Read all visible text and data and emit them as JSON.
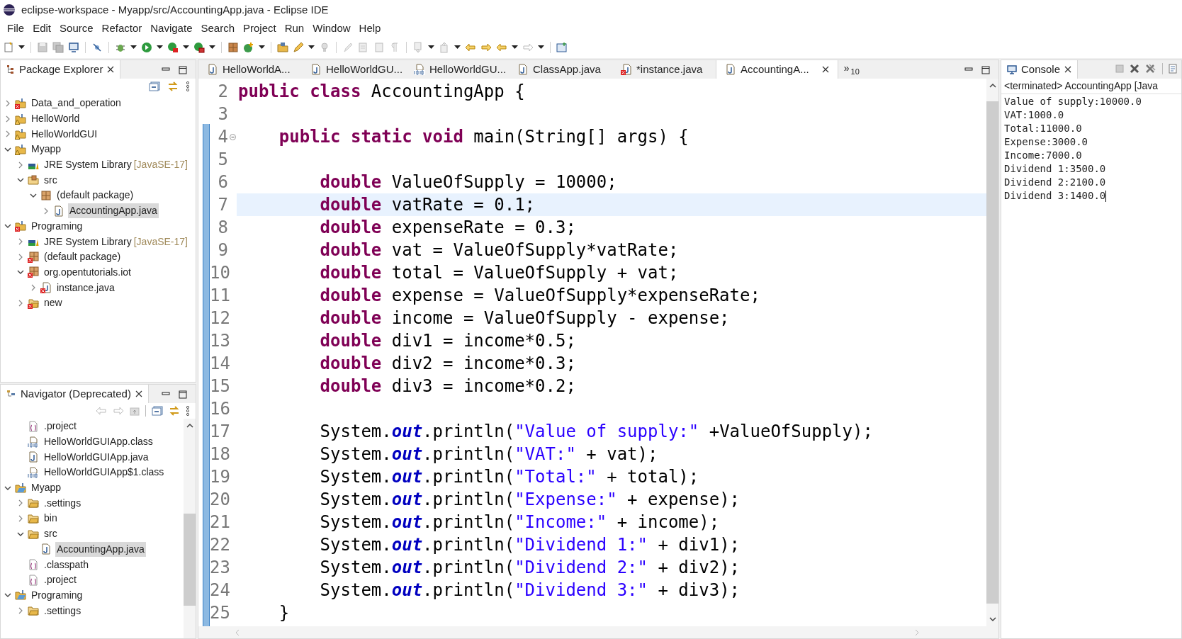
{
  "window": {
    "title": "eclipse-workspace - Myapp/src/AccountingApp.java - Eclipse IDE"
  },
  "menu": [
    {
      "label": "File"
    },
    {
      "label": "Edit"
    },
    {
      "label": "Source"
    },
    {
      "label": "Refactor"
    },
    {
      "label": "Navigate"
    },
    {
      "label": "Search"
    },
    {
      "label": "Project"
    },
    {
      "label": "Run"
    },
    {
      "label": "Window"
    },
    {
      "label": "Help"
    }
  ],
  "package_explorer": {
    "title": "Package Explorer",
    "items": [
      {
        "label": "Data_and_operation",
        "kind": "project-error",
        "expanded": false,
        "selected": false
      },
      {
        "label": "HelloWorld",
        "kind": "project-warning",
        "expanded": false,
        "selected": false
      },
      {
        "label": "HelloWorldGUI",
        "kind": "project-warning",
        "expanded": false,
        "selected": false
      },
      {
        "label": "Myapp",
        "kind": "project-warning",
        "expanded": true,
        "selected": false,
        "children": [
          {
            "label": "JRE System Library",
            "suffix": "[JavaSE-17]",
            "kind": "library",
            "expanded": false,
            "selected": false
          },
          {
            "label": "src",
            "kind": "source-folder",
            "expanded": true,
            "selected": false,
            "children": [
              {
                "label": "(default package)",
                "kind": "package",
                "expanded": true,
                "selected": false,
                "children": [
                  {
                    "label": "AccountingApp.java",
                    "kind": "java-file",
                    "expanded": false,
                    "selected": true
                  }
                ]
              }
            ]
          }
        ]
      },
      {
        "label": "Programing",
        "kind": "project-error",
        "expanded": true,
        "selected": false,
        "children": [
          {
            "label": "JRE System Library",
            "suffix": "[JavaSE-17]",
            "kind": "library",
            "expanded": false,
            "selected": false
          },
          {
            "label": "(default package)",
            "kind": "package-error",
            "expanded": false,
            "selected": false
          },
          {
            "label": "org.opentutorials.iot",
            "kind": "package-error",
            "expanded": true,
            "selected": false,
            "children": [
              {
                "label": "instance.java",
                "kind": "java-error",
                "expanded": false,
                "selected": false
              }
            ]
          },
          {
            "label": "new",
            "kind": "folder-error",
            "expanded": false,
            "selected": false
          }
        ]
      }
    ]
  },
  "navigator": {
    "title": "Navigator (Deprecated)",
    "continued_items": [
      {
        "label": ".project",
        "kind": "config-file",
        "selected": false
      },
      {
        "label": "HelloWorldGUIApp.class",
        "kind": "class-file",
        "selected": false
      },
      {
        "label": "HelloWorldGUIApp.java",
        "kind": "java-file",
        "selected": false
      },
      {
        "label": "HelloWorldGUIApp$1.class",
        "kind": "class-file",
        "selected": false
      }
    ],
    "items": [
      {
        "label": "Myapp",
        "kind": "project",
        "expanded": true,
        "selected": false,
        "children": [
          {
            "label": ".settings",
            "kind": "folder",
            "expanded": false,
            "selected": false
          },
          {
            "label": "bin",
            "kind": "folder",
            "expanded": false,
            "selected": false
          },
          {
            "label": "src",
            "kind": "folder",
            "expanded": true,
            "selected": false,
            "children": [
              {
                "label": "AccountingApp.java",
                "kind": "java-file",
                "selected": true
              }
            ]
          },
          {
            "label": ".classpath",
            "kind": "config-file",
            "selected": false
          },
          {
            "label": ".project",
            "kind": "config-file",
            "selected": false
          }
        ]
      },
      {
        "label": "Programing",
        "kind": "project",
        "expanded": true,
        "selected": false,
        "children": [
          {
            "label": ".settings",
            "kind": "folder",
            "expanded": false,
            "selected": false
          }
        ]
      }
    ]
  },
  "editor": {
    "tabs": [
      {
        "label": "HelloWorldA...",
        "kind": "java-file",
        "selected": false
      },
      {
        "label": "HelloWorldGU...",
        "kind": "java-file",
        "selected": false
      },
      {
        "label": "HelloWorldGU...",
        "kind": "class-file",
        "selected": false
      },
      {
        "label": "ClassApp.java",
        "kind": "java-file",
        "selected": false
      },
      {
        "label": "*instance.java",
        "kind": "java-error",
        "selected": false
      },
      {
        "label": "AccountingA...",
        "kind": "java-file",
        "selected": true
      }
    ],
    "overflow_marker": "»",
    "overflow_count": "10",
    "lines": [
      {
        "number": "2",
        "current": false,
        "fold": false,
        "tokens": [
          {
            "kind": "keyword",
            "text": "public class"
          },
          {
            "kind": "plain",
            "text": " AccountingApp {"
          }
        ]
      },
      {
        "number": "3",
        "current": false,
        "fold": false
      },
      {
        "number": "4",
        "current": false,
        "fold": true,
        "tokens": [
          {
            "kind": "keyword",
            "text": "    public static void"
          },
          {
            "kind": "plain",
            "text": " main(String[] args) {"
          }
        ]
      },
      {
        "number": "5",
        "current": false,
        "fold": false
      },
      {
        "number": "6",
        "current": false,
        "fold": false,
        "tokens": [
          {
            "kind": "keyword",
            "text": "        double"
          },
          {
            "kind": "plain",
            "text": " ValueOfSupply = 10000;"
          }
        ]
      },
      {
        "number": "7",
        "current": true,
        "fold": false,
        "tokens": [
          {
            "kind": "keyword",
            "text": "        double"
          },
          {
            "kind": "plain",
            "text": " vatRate = 0.1;"
          }
        ]
      },
      {
        "number": "8",
        "current": false,
        "fold": false,
        "tokens": [
          {
            "kind": "keyword",
            "text": "        double"
          },
          {
            "kind": "plain",
            "text": " expenseRate = 0.3;"
          }
        ]
      },
      {
        "number": "9",
        "current": false,
        "fold": false,
        "tokens": [
          {
            "kind": "keyword",
            "text": "        double"
          },
          {
            "kind": "plain",
            "text": " vat = ValueOfSupply*vatRate;"
          }
        ]
      },
      {
        "number": "10",
        "current": false,
        "fold": false,
        "tokens": [
          {
            "kind": "keyword",
            "text": "        double"
          },
          {
            "kind": "plain",
            "text": " total = ValueOfSupply + vat;"
          }
        ]
      },
      {
        "number": "11",
        "current": false,
        "fold": false,
        "tokens": [
          {
            "kind": "keyword",
            "text": "        double"
          },
          {
            "kind": "plain",
            "text": " expense = ValueOfSupply*expenseRate;"
          }
        ]
      },
      {
        "number": "12",
        "current": false,
        "fold": false,
        "tokens": [
          {
            "kind": "keyword",
            "text": "        double"
          },
          {
            "kind": "plain",
            "text": " income = ValueOfSupply - expense;"
          }
        ]
      },
      {
        "number": "13",
        "current": false,
        "fold": false,
        "tokens": [
          {
            "kind": "keyword",
            "text": "        double"
          },
          {
            "kind": "plain",
            "text": " div1 = income*0.5;"
          }
        ]
      },
      {
        "number": "14",
        "current": false,
        "fold": false,
        "tokens": [
          {
            "kind": "keyword",
            "text": "        double"
          },
          {
            "kind": "plain",
            "text": " div2 = income*0.3;"
          }
        ]
      },
      {
        "number": "15",
        "current": false,
        "fold": false,
        "tokens": [
          {
            "kind": "keyword",
            "text": "        double"
          },
          {
            "kind": "plain",
            "text": " div3 = income*0.2;"
          }
        ]
      },
      {
        "number": "16",
        "current": false,
        "fold": false
      },
      {
        "number": "17",
        "current": false,
        "fold": false,
        "tokens": [
          {
            "kind": "plain",
            "text": "        System."
          },
          {
            "kind": "static-field",
            "text": "out"
          },
          {
            "kind": "plain",
            "text": ".println("
          },
          {
            "kind": "string",
            "text": "\"Value of supply:\""
          },
          {
            "kind": "plain",
            "text": " +ValueOfSupply);"
          }
        ]
      },
      {
        "number": "18",
        "current": false,
        "fold": false,
        "tokens": [
          {
            "kind": "plain",
            "text": "        System."
          },
          {
            "kind": "static-field",
            "text": "out"
          },
          {
            "kind": "plain",
            "text": ".println("
          },
          {
            "kind": "string",
            "text": "\"VAT:\""
          },
          {
            "kind": "plain",
            "text": " + vat);"
          }
        ]
      },
      {
        "number": "19",
        "current": false,
        "fold": false,
        "tokens": [
          {
            "kind": "plain",
            "text": "        System."
          },
          {
            "kind": "static-field",
            "text": "out"
          },
          {
            "kind": "plain",
            "text": ".println("
          },
          {
            "kind": "string",
            "text": "\"Total:\""
          },
          {
            "kind": "plain",
            "text": " + total);"
          }
        ]
      },
      {
        "number": "20",
        "current": false,
        "fold": false,
        "tokens": [
          {
            "kind": "plain",
            "text": "        System."
          },
          {
            "kind": "static-field",
            "text": "out"
          },
          {
            "kind": "plain",
            "text": ".println("
          },
          {
            "kind": "string",
            "text": "\"Expense:\""
          },
          {
            "kind": "plain",
            "text": " + expense);"
          }
        ]
      },
      {
        "number": "21",
        "current": false,
        "fold": false,
        "tokens": [
          {
            "kind": "plain",
            "text": "        System."
          },
          {
            "kind": "static-field",
            "text": "out"
          },
          {
            "kind": "plain",
            "text": ".println("
          },
          {
            "kind": "string",
            "text": "\"Income:\""
          },
          {
            "kind": "plain",
            "text": " + income);"
          }
        ]
      },
      {
        "number": "22",
        "current": false,
        "fold": false,
        "tokens": [
          {
            "kind": "plain",
            "text": "        System."
          },
          {
            "kind": "static-field",
            "text": "out"
          },
          {
            "kind": "plain",
            "text": ".println("
          },
          {
            "kind": "string",
            "text": "\"Dividend 1:\""
          },
          {
            "kind": "plain",
            "text": " + div1);"
          }
        ]
      },
      {
        "number": "23",
        "current": false,
        "fold": false,
        "tokens": [
          {
            "kind": "plain",
            "text": "        System."
          },
          {
            "kind": "static-field",
            "text": "out"
          },
          {
            "kind": "plain",
            "text": ".println("
          },
          {
            "kind": "string",
            "text": "\"Dividend 2:\""
          },
          {
            "kind": "plain",
            "text": " + div2);"
          }
        ]
      },
      {
        "number": "24",
        "current": false,
        "fold": false,
        "tokens": [
          {
            "kind": "plain",
            "text": "        System."
          },
          {
            "kind": "static-field",
            "text": "out"
          },
          {
            "kind": "plain",
            "text": ".println("
          },
          {
            "kind": "string",
            "text": "\"Dividend 3:\""
          },
          {
            "kind": "plain",
            "text": " + div3);"
          }
        ]
      },
      {
        "number": "25",
        "current": false,
        "fold": false,
        "tokens": [
          {
            "kind": "plain",
            "text": "    }"
          }
        ]
      }
    ]
  },
  "console": {
    "title": "Console",
    "status": "<terminated> AccountingApp [Java",
    "output": [
      "Value of supply:10000.0",
      "VAT:1000.0",
      "Total:11000.0",
      "Expense:3000.0",
      "Income:7000.0",
      "Dividend 1:3500.0",
      "Dividend 2:2100.0",
      "Dividend 3:1400.0"
    ]
  }
}
